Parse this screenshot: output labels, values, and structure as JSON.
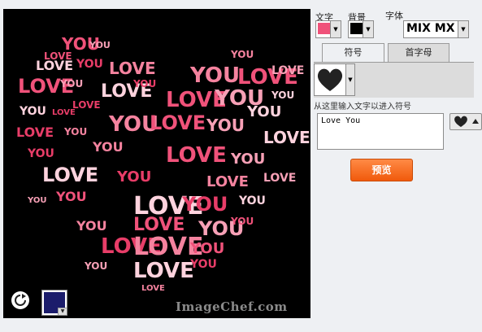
{
  "canvas": {
    "watermark": "ImageChef.com",
    "background_color": "#000000",
    "text_color": "#f0527a",
    "words": [
      "YOU",
      "YOU",
      "LOVE",
      "YOU",
      "LOVE",
      "LOVE",
      "YOU",
      "LOVE",
      "YOU",
      "YOU",
      "LOVE",
      "LOVE",
      "YOU",
      "LOVE",
      "YOU",
      "LOVE",
      "YOU",
      "YOU",
      "LOVE",
      "YOU",
      "LOVE",
      "YOU",
      "LOVE",
      "YOU",
      "YOU",
      "LOVE",
      "YOU",
      "LOVE",
      "YOU",
      "LOVE",
      "YOU",
      "LOVE",
      "LOVE",
      "YOU",
      "YOU",
      "LOVE",
      "YOU",
      "YOU",
      "LOVE",
      "LOVE",
      "YOU",
      "YOU",
      "LOVE",
      "YOU",
      "LOVE",
      "YOU",
      "YOU",
      "YOU",
      "LOVE",
      "YOU",
      "LOVE"
    ]
  },
  "controls": {
    "text_color_label": "文字",
    "bg_label": "背景",
    "font_label": "字体",
    "text_color": "#f0527a",
    "bg_color": "#000000",
    "font_name": "MIX MX",
    "canvas_bg_color": "#1b1c6b"
  },
  "tabs": [
    {
      "label": "符号",
      "active": true
    },
    {
      "label": "首字母",
      "active": false
    }
  ],
  "symbol": {
    "icon": "black-heart-icon"
  },
  "hint_text": "从这里输入文字以进入符号",
  "text_input": {
    "value": "Love You"
  },
  "preview_button": "预览"
}
